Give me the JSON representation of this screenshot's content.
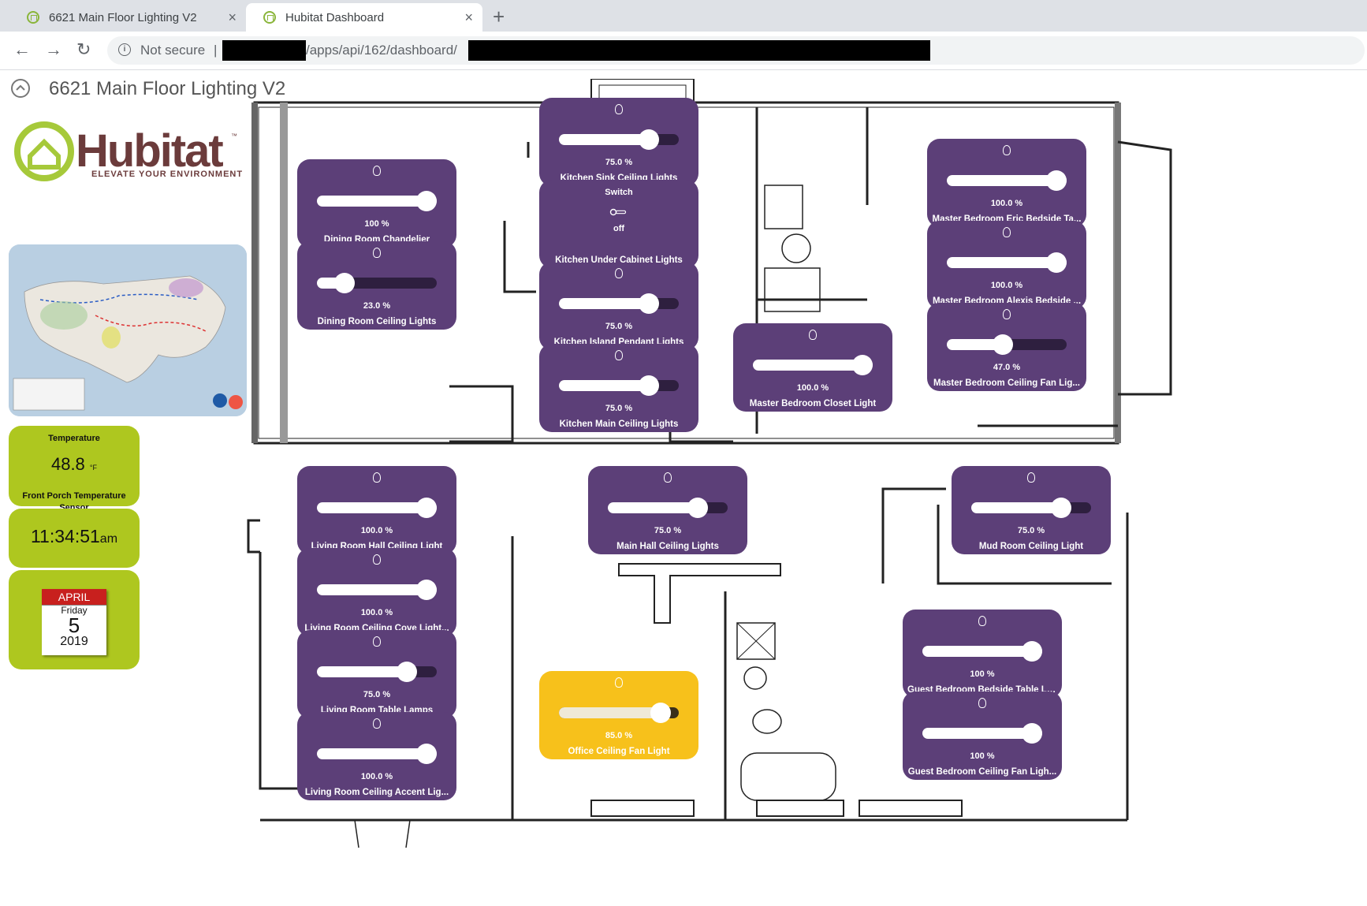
{
  "browser": {
    "tabs": [
      {
        "title": "6621 Main Floor Lighting V2",
        "close": "×"
      },
      {
        "title": "Hubitat Dashboard",
        "close": "×"
      }
    ],
    "new_tab": "+",
    "nav": {
      "back": "←",
      "forward": "→",
      "reload": "↻"
    },
    "security_label": "Not secure",
    "separator": "|",
    "url_visible": "/apps/api/162/dashboard/"
  },
  "dashboard": {
    "title": "6621 Main Floor Lighting V2",
    "logo": {
      "brand": "Hubitat",
      "tagline": "ELEVATE YOUR ENVIRONMENT",
      "tm": "™"
    }
  },
  "widgets": {
    "temperature": {
      "title": "Temperature",
      "value": "48.8",
      "unit": "°F",
      "name": "Front Porch Temperature Sensor"
    },
    "clock": {
      "time": "11:34:51",
      "ampm": "am"
    },
    "calendar": {
      "month": "APRIL",
      "weekday": "Friday",
      "day": "5",
      "year": "2019"
    }
  },
  "tiles": [
    {
      "name": "Kitchen Sink Ceiling Lights",
      "pct_label": "75.0 %",
      "level": 75,
      "style": "purple"
    },
    {
      "name": "Dining Room Chandelier",
      "pct_label": "100 %",
      "level": 100,
      "style": "purple"
    },
    {
      "name": "Dining Room Ceiling Lights",
      "pct_label": "23.0 %",
      "level": 23,
      "style": "purple"
    },
    {
      "name": "Kitchen Island Pendant Lights",
      "pct_label": "75.0 %",
      "level": 75,
      "style": "purple"
    },
    {
      "name": "Kitchen Main Ceiling Lights",
      "pct_label": "75.0 %",
      "level": 75,
      "style": "purple"
    },
    {
      "name": "Master Bedroom Eric Bedside Ta...",
      "pct_label": "100.0 %",
      "level": 100,
      "style": "purple"
    },
    {
      "name": "Master Bedroom Alexis Bedside ...",
      "pct_label": "100.0 %",
      "level": 100,
      "style": "purple"
    },
    {
      "name": "Master Bedroom Ceiling Fan Lig...",
      "pct_label": "47.0 %",
      "level": 47,
      "style": "purple"
    },
    {
      "name": "Master Bedroom Closet Light",
      "pct_label": "100.0 %",
      "level": 100,
      "style": "purple"
    },
    {
      "name": "Living Room Hall Ceiling Light",
      "pct_label": "100.0 %",
      "level": 100,
      "style": "purple"
    },
    {
      "name": "Living Room Ceiling Cove Light...",
      "pct_label": "100.0 %",
      "level": 100,
      "style": "purple"
    },
    {
      "name": "Living Room Table Lamps",
      "pct_label": "75.0 %",
      "level": 75,
      "style": "purple"
    },
    {
      "name": "Living Room Ceiling Accent Lig...",
      "pct_label": "100.0 %",
      "level": 100,
      "style": "purple"
    },
    {
      "name": "Main Hall Ceiling Lights",
      "pct_label": "75.0 %",
      "level": 75,
      "style": "purple"
    },
    {
      "name": "Mud Room Ceiling Light",
      "pct_label": "75.0 %",
      "level": 75,
      "style": "purple"
    },
    {
      "name": "Guest Bedroom Bedside Table La...",
      "pct_label": "100 %",
      "level": 100,
      "style": "purple"
    },
    {
      "name": "Guest Bedroom Ceiling Fan Ligh...",
      "pct_label": "100 %",
      "level": 100,
      "style": "purple"
    },
    {
      "name": "Office Ceiling Fan Light",
      "pct_label": "85.0 %",
      "level": 85,
      "style": "yellow"
    }
  ],
  "switch_tile": {
    "label": "Switch",
    "state": "off",
    "name": "Kitchen Under Cabinet Lights"
  },
  "colors": {
    "tile_purple": "#5c3f78",
    "tile_yellow": "#f7c11b",
    "widget_green": "#aec71f",
    "calendar_red": "#c8201e"
  }
}
